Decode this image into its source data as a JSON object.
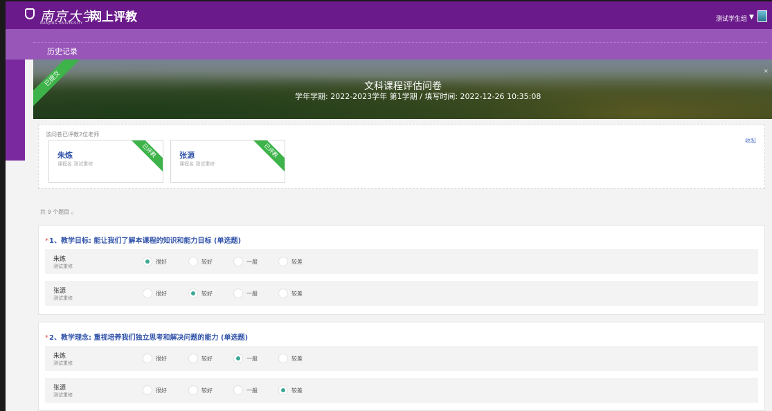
{
  "header": {
    "logo_text": "南京大学",
    "logo_subtext": "NANJING UNIVERSITY",
    "site_title": "网上评教",
    "user_name": "测试学生组",
    "caret": "▼"
  },
  "subheader": {
    "history_label": "历史记录"
  },
  "banner": {
    "status_ribbon": "已提交",
    "title": "文科课程评估问卷",
    "subtitle": "学年学期: 2022-2023学年 第1学期 / 填写时间: 2022-12-26 10:35:08",
    "close_label": "×"
  },
  "teachers": {
    "header": "该问卷已评教2位老师",
    "collapse_label": "收起",
    "cards": [
      {
        "name": "朱炼",
        "course": "课程名    测试重修",
        "ribbon": "已评教"
      },
      {
        "name": "张源",
        "course": "课程名    测试重修",
        "ribbon": "已评教"
      }
    ]
  },
  "summary": {
    "count_text": "共 9 个题目 。"
  },
  "questions": [
    {
      "required_mark": "*",
      "title": "1、教学目标: 能让我们了解本课程的知识和能力目标 (单选题)",
      "rows": [
        {
          "teacher": "朱炼",
          "course": "测试重修",
          "options": [
            {
              "label": "很好",
              "selected": true
            },
            {
              "label": "较好",
              "selected": false
            },
            {
              "label": "一般",
              "selected": false
            },
            {
              "label": "较差",
              "selected": false
            }
          ]
        },
        {
          "teacher": "张源",
          "course": "测试重修",
          "options": [
            {
              "label": "很好",
              "selected": false
            },
            {
              "label": "较好",
              "selected": true
            },
            {
              "label": "一般",
              "selected": false
            },
            {
              "label": "较差",
              "selected": false
            }
          ]
        }
      ]
    },
    {
      "required_mark": "*",
      "title": "2、教学理念: 重视培养我们独立思考和解决问题的能力 (单选题)",
      "rows": [
        {
          "teacher": "朱炼",
          "course": "测试重修",
          "options": [
            {
              "label": "很好",
              "selected": false
            },
            {
              "label": "较好",
              "selected": false
            },
            {
              "label": "一般",
              "selected": true
            },
            {
              "label": "较差",
              "selected": false
            }
          ]
        },
        {
          "teacher": "张源",
          "course": "测试重修",
          "options": [
            {
              "label": "很好",
              "selected": false
            },
            {
              "label": "较好",
              "selected": false
            },
            {
              "label": "一般",
              "selected": false
            },
            {
              "label": "较差",
              "selected": true
            }
          ]
        }
      ]
    }
  ],
  "colors": {
    "topbar": "#6a1a8a",
    "subheader": "#9856b9",
    "link_blue": "#3355aa",
    "ribbon_green": "#3db34a",
    "radio_selected": "#3aa894",
    "required_red": "#e35050"
  }
}
